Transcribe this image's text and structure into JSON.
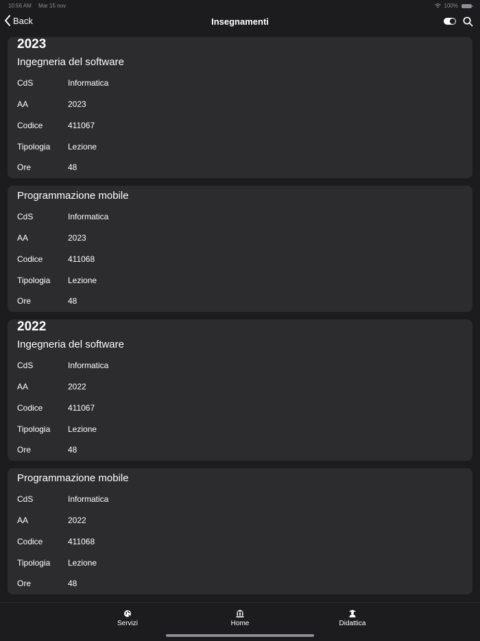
{
  "status_bar": {
    "time": "10:56 AM",
    "date": "Mar 15 nov",
    "battery": "100%"
  },
  "navbar": {
    "back_label": "Back",
    "title": "Insegnamenti"
  },
  "sections": [
    {
      "year": "2023",
      "courses": [
        {
          "title": "Ingegneria del software",
          "rows": [
            {
              "label": "CdS",
              "value": "Informatica"
            },
            {
              "label": "AA",
              "value": "2023"
            },
            {
              "label": "Codice",
              "value": "411067"
            },
            {
              "label": "Tipologia",
              "value": "Lezione"
            },
            {
              "label": "Ore",
              "value": "48"
            }
          ]
        },
        {
          "title": "Programmazione mobile",
          "rows": [
            {
              "label": "CdS",
              "value": "Informatica"
            },
            {
              "label": "AA",
              "value": "2023"
            },
            {
              "label": "Codice",
              "value": "411068"
            },
            {
              "label": "Tipologia",
              "value": "Lezione"
            },
            {
              "label": "Ore",
              "value": "48"
            }
          ]
        }
      ]
    },
    {
      "year": "2022",
      "courses": [
        {
          "title": "Ingegneria del software",
          "rows": [
            {
              "label": "CdS",
              "value": "Informatica"
            },
            {
              "label": "AA",
              "value": "2022"
            },
            {
              "label": "Codice",
              "value": "411067"
            },
            {
              "label": "Tipologia",
              "value": "Lezione"
            },
            {
              "label": "Ore",
              "value": "48"
            }
          ]
        },
        {
          "title": "Programmazione mobile",
          "rows": [
            {
              "label": "CdS",
              "value": "Informatica"
            },
            {
              "label": "AA",
              "value": "2022"
            },
            {
              "label": "Codice",
              "value": "411068"
            },
            {
              "label": "Tipologia",
              "value": "Lezione"
            },
            {
              "label": "Ore",
              "value": "48"
            }
          ]
        }
      ]
    }
  ],
  "tabbar": {
    "items": [
      {
        "label": "Servizi",
        "icon": "globe-icon"
      },
      {
        "label": "Home",
        "icon": "building-icon"
      },
      {
        "label": "Didattica",
        "icon": "graduate-icon"
      }
    ]
  }
}
